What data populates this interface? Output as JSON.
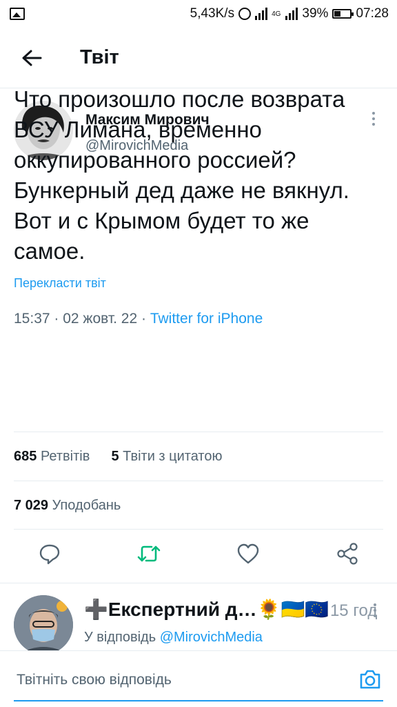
{
  "status_bar": {
    "speed": "5,43K/s",
    "network": "4G",
    "battery": "39%",
    "time": "07:28"
  },
  "header": {
    "title": "Твіт"
  },
  "tweet": {
    "author_name": "Максим Мирович",
    "author_handle": "@MirovichMedia",
    "text": "Что произошло после возврата ВСУ Лимана, временно оккупированного россией? Бункерный дед даже не вякнул. Вот и с Крымом будет то же самое.",
    "translate_label": "Перекласти твіт",
    "time": "15:37",
    "date": "02 жовт. 22",
    "source": "Twitter for iPhone",
    "retweets_count": "685",
    "retweets_label": "Ретвітів",
    "quotes_count": "5",
    "quotes_label": "Твіти з цитатою",
    "likes_count": "7 029",
    "likes_label": "Уподобань"
  },
  "actions": [
    "reply-icon",
    "retweet-icon",
    "like-icon",
    "share-icon"
  ],
  "reply": {
    "author_name": "➕Експертний д…🌻🇺🇦🇪🇺",
    "meta_clipped": "15 год",
    "replying_to_label": "У відповідь",
    "replying_to_handle": "@MirovichMedia"
  },
  "composer": {
    "placeholder": "Твітніть свою відповідь"
  },
  "colors": {
    "accent": "#1d9bf0",
    "retweet_green": "#00ba7c",
    "secondary_text": "#536471"
  }
}
